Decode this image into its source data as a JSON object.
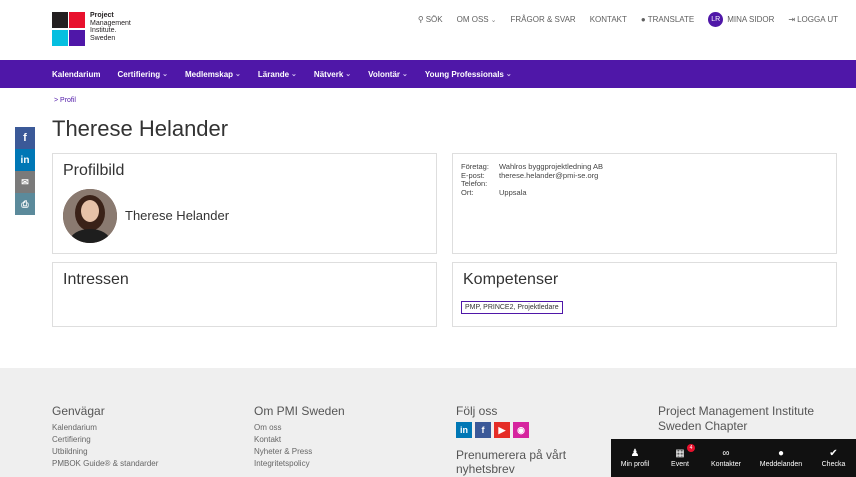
{
  "header": {
    "logo_lines": [
      "Project",
      "Management",
      "Institute.",
      "Sweden"
    ],
    "search": "SÖK",
    "om_oss": "OM OSS",
    "fragor": "FRÅGOR & SVAR",
    "kontakt": "KONTAKT",
    "translate": "TRANSLATE",
    "avatar_initials": "LR",
    "mina_sidor": "MINA SIDOR",
    "logga_ut": "LOGGA UT"
  },
  "nav": [
    "Kalendarium",
    "Certifiering",
    "Medlemskap",
    "Lärande",
    "Nätverk",
    "Volontär",
    "Young Professionals"
  ],
  "nav_dropdown": [
    false,
    true,
    true,
    true,
    true,
    true,
    true
  ],
  "breadcrumb": "> Profil",
  "page_title": "Therese Helander",
  "profile_card": {
    "title": "Profilbild",
    "name": "Therese Helander"
  },
  "info": {
    "foretag_label": "Företag:",
    "foretag": "Wahlros byggprojektledning AB",
    "epost_label": "E-post:",
    "epost": "therese.helander@pmi-se.org",
    "telefon_label": "Telefon:",
    "telefon": "",
    "ort_label": "Ort:",
    "ort": "Uppsala"
  },
  "intressen": {
    "title": "Intressen"
  },
  "kompetenser": {
    "title": "Kompetenser",
    "tag": "PMP, PRINCE2, Projektledare"
  },
  "footer": {
    "genvagar": {
      "title": "Genvägar",
      "links": [
        "Kalendarium",
        "Certifiering",
        "Utbildning",
        "PMBOK Guide® & standarder"
      ]
    },
    "om": {
      "title": "Om PMI Sweden",
      "links": [
        "Om oss",
        "Kontakt",
        "Nyheter & Press",
        "Integritetspolicy"
      ]
    },
    "folj": {
      "title": "Följ oss",
      "subscribe": "Prenumerera på vårt nyhetsbrev"
    },
    "pmi": {
      "title": "Project Management Institute Sweden Chapter"
    }
  },
  "actionbar": {
    "min_profil": "Min profil",
    "event": "Event",
    "event_badge": "4",
    "kontakter": "Kontakter",
    "meddelanden": "Meddelanden",
    "checka": "Checka"
  },
  "colors": {
    "brand_purple": "#4f17a8",
    "facebook": "#3b5998",
    "linkedin": "#0077b5",
    "youtube": "#e52d27",
    "instagram": "#d6249f"
  }
}
